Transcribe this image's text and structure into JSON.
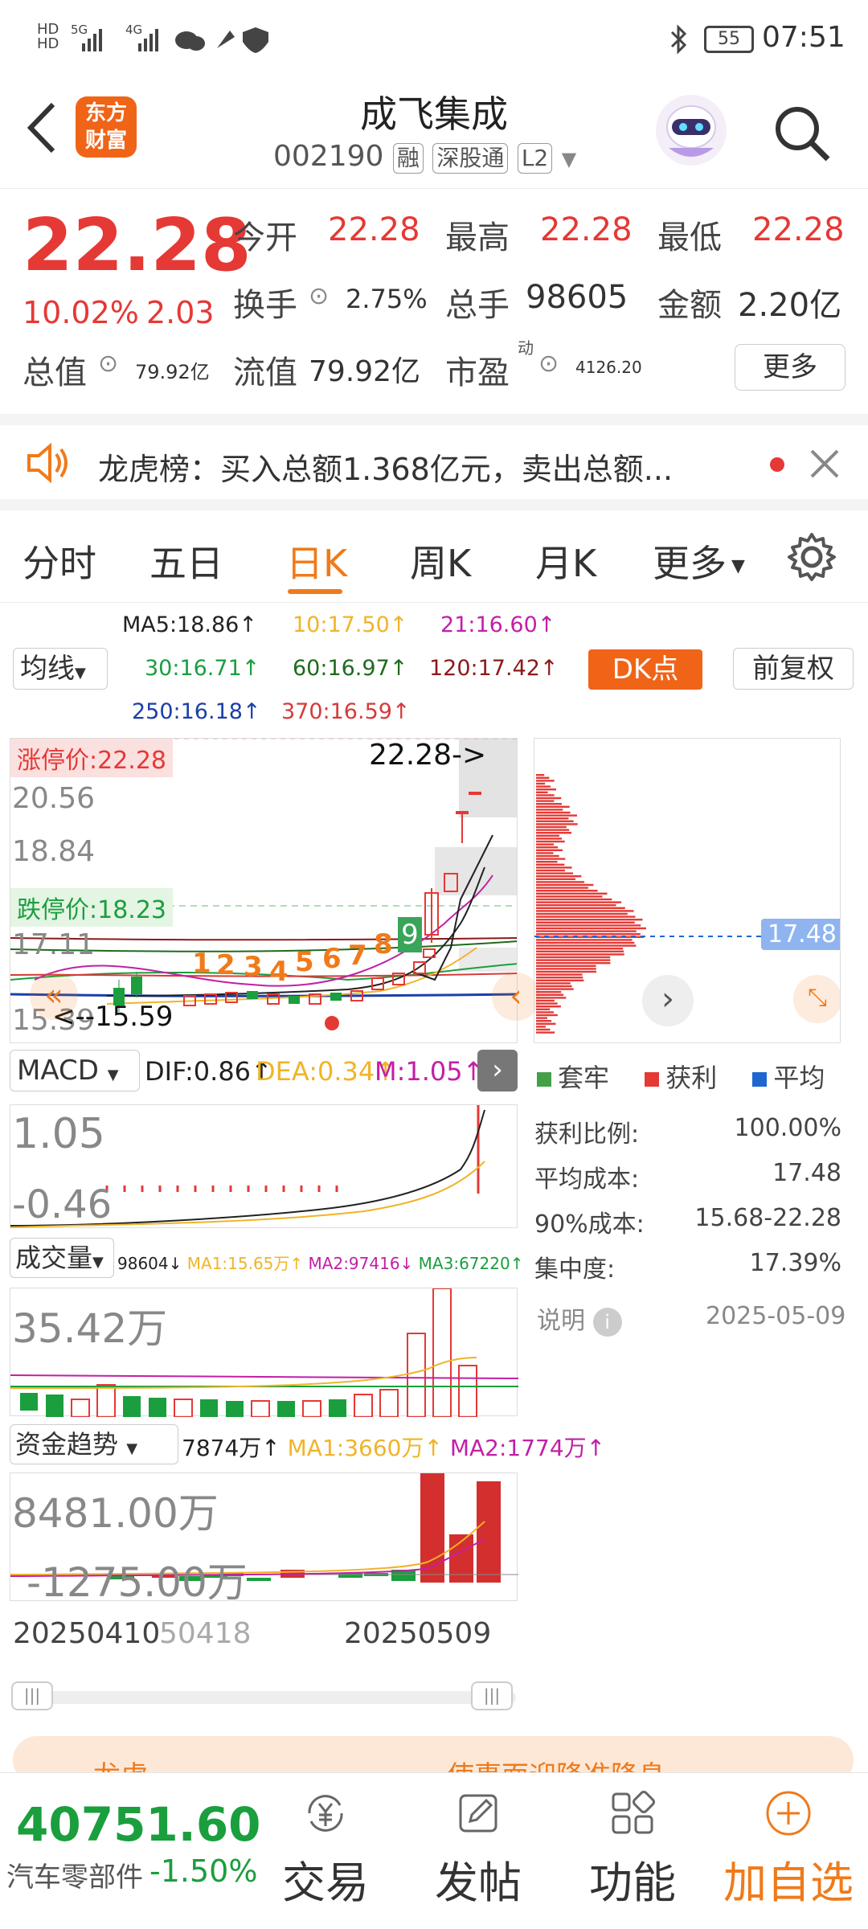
{
  "status": {
    "time": "07:51",
    "battery": "55",
    "signal_left": "HD",
    "net1": "5G",
    "net2": "4G"
  },
  "header": {
    "title": "成飞集成",
    "code": "002190",
    "badges": [
      "融",
      "深股通",
      "L2"
    ],
    "logo_text": [
      "东方",
      "财富"
    ]
  },
  "quote": {
    "price": "22.28",
    "change_pct": "10.02%",
    "change": "2.03",
    "rows": [
      [
        {
          "label": "今开",
          "value": "22.28"
        },
        {
          "label": "最高",
          "value": "22.28"
        },
        {
          "label": "最低",
          "value": "22.28"
        }
      ],
      [
        {
          "label": "换手",
          "value": "2.75%"
        },
        {
          "label": "总手",
          "value": "98605"
        },
        {
          "label": "金额",
          "value": "2.20亿"
        }
      ],
      [
        {
          "label": "流值",
          "value": "79.92亿"
        },
        {
          "label": "市盈",
          "value": "4126.20",
          "sup": "动"
        }
      ]
    ],
    "total_label": "总值",
    "total_value": "79.92亿",
    "more": "更多"
  },
  "notice": {
    "text": "龙虎榜：买入总额1.368亿元，卖出总额..."
  },
  "tabs": [
    {
      "label": "分时"
    },
    {
      "label": "五日"
    },
    {
      "label": "日K"
    },
    {
      "label": "周K"
    },
    {
      "label": "月K"
    },
    {
      "label": "更多"
    }
  ],
  "ma_panel": {
    "selector": "均线",
    "ma5": "MA5:18.86↑",
    "ma10": "10:17.50↑",
    "ma21": "21:16.60↑",
    "ma30": "30:16.71↑",
    "ma60": "60:16.97↑",
    "ma120": "120:17.42↑",
    "ma250": "250:16.18↑",
    "ma370": "370:16.59↑",
    "dk": "DK点",
    "fq": "前复权"
  },
  "kline": {
    "limit_up": "涨停价:22.28",
    "price_arrow": "22.28->",
    "limit_down": "跌停价:18.23",
    "y_ticks": [
      "20.56",
      "18.84",
      "17.11",
      "15.39"
    ],
    "low_label": "<--15.59",
    "seq": [
      "1",
      "2",
      "3",
      "4",
      "5",
      "6",
      "7",
      "8",
      "9"
    ]
  },
  "chips": {
    "avg_label": "17.48",
    "legend": [
      {
        "name": "套牢",
        "color": "#43a047"
      },
      {
        "name": "获利",
        "color": "#e53935"
      },
      {
        "name": "平均",
        "color": "#1e66d0"
      }
    ],
    "stats": [
      {
        "k": "获利比例:",
        "v": "100.00%"
      },
      {
        "k": "平均成本:",
        "v": "17.48"
      },
      {
        "k": "90%成本:",
        "v": "15.68-22.28"
      },
      {
        "k": "集中度:",
        "v": "17.39%"
      }
    ],
    "note": "说明",
    "date": "2025-05-09"
  },
  "macd": {
    "selector": "MACD",
    "dif": "DIF:0.86↑",
    "dea": "DEA:0.34↑",
    "m": "M:1.05↑",
    "ticks": [
      "1.05",
      "-0.46"
    ]
  },
  "volume": {
    "selector": "成交量",
    "info": "98604↓",
    "ma1": "MA1:15.65万↑",
    "ma2": "MA2:97416↓",
    "ma3": "MA3:67220↑",
    "tick": "35.42万"
  },
  "fund": {
    "selector": "资金趋势",
    "info": "7874万↑",
    "ma1": "MA1:3660万↑",
    "ma2": "MA2:1774万↑",
    "ticks": [
      "8481.00万",
      "-1275.00万"
    ]
  },
  "dates": {
    "start": "20250410",
    "mid": "50418",
    "end": "20250509"
  },
  "banner": {
    "left": "龙虎...",
    "right": "使事面迎降准降息"
  },
  "bottom": {
    "index_value": "40751.60",
    "index_name": "汽车零部件",
    "index_change": "-1.50%",
    "nav": [
      {
        "label": "交易"
      },
      {
        "label": "发帖"
      },
      {
        "label": "功能"
      },
      {
        "label": "加自选"
      }
    ]
  },
  "colors": {
    "accent": "#f07a1a",
    "up": "#e53935",
    "down": "#1b9e3e",
    "brand": "#f06418"
  }
}
